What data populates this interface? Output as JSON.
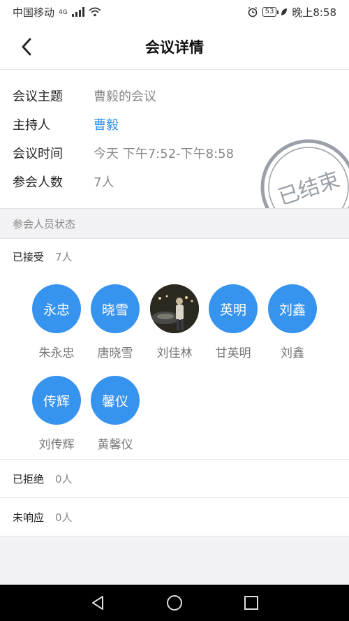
{
  "status_bar": {
    "carrier": "中国移动",
    "network": "4G",
    "battery": "53",
    "time": "晚上8:58"
  },
  "header": {
    "title": "会议详情"
  },
  "meeting": {
    "topic_label": "会议主题",
    "topic_value": "曹毅的会议",
    "host_label": "主持人",
    "host_value": "曹毅",
    "time_label": "会议时间",
    "time_value": "今天 下午7:52-下午8:58",
    "count_label": "参会人数",
    "count_value": "7人",
    "stamp_text": "已结束"
  },
  "attendee_section": {
    "title": "参会人员状态",
    "accepted_label": "已接受",
    "accepted_count": "7人",
    "attendees": [
      {
        "avatar_text": "永忠",
        "name": "朱永忠"
      },
      {
        "avatar_text": "晓雪",
        "name": "唐晓雪"
      },
      {
        "avatar_text": "",
        "name": "刘佳林"
      },
      {
        "avatar_text": "英明",
        "name": "甘英明"
      },
      {
        "avatar_text": "刘鑫",
        "name": "刘鑫"
      },
      {
        "avatar_text": "传辉",
        "name": "刘传辉"
      },
      {
        "avatar_text": "馨仪",
        "name": "黄馨仪"
      }
    ],
    "rejected_label": "已拒绝",
    "rejected_count": "0人",
    "no_response_label": "未响应",
    "no_response_count": "0人"
  },
  "colors": {
    "accent": "#3693ee",
    "link": "#2b8ef0",
    "stamp": "#9aa0a8"
  }
}
